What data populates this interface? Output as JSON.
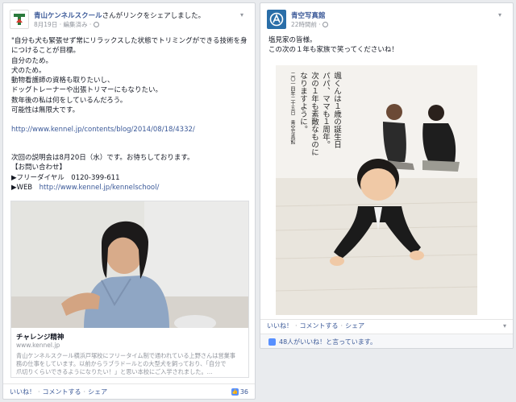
{
  "post1": {
    "page_name": "青山ケンネルスクール",
    "action_text": "さんがリンクをシェアしました。",
    "meta": "8月19日 · 編集済み ·",
    "lines": [
      "\"自分も犬も緊張せず常にリラックスした状態でトリミングができる技術を身",
      "につけることが目標。",
      "自分のため。",
      "犬のため。",
      "動物看護師の資格も取りたいし、",
      "ドッグトレーナーや出張トリマーにもなりたい。",
      "数年後の私は何をしているんだろう。",
      "可能性は無限大です。"
    ],
    "url1": "http://www.kennel.jp/contents/blog/2014/08/18/4332/",
    "lines2": [
      "次回の説明会は8月20日（水）です。お待ちしております。",
      "【お問い合わせ】",
      "▶フリーダイヤル　0120-399-611"
    ],
    "web_label": "▶WEB",
    "web_url": "http://www.kennel.jp/kennelschool/",
    "link_title": "チャレンジ精神",
    "link_domain": "www.kennel.jp",
    "link_desc": [
      "青山ケンネルスクール横浜戸塚校にフリータイム制で通われている上野さんは営業事",
      "務の仕事をしています。以前からラブラドールとの大型犬を飼っており、「自分で",
      "爪切りくらいできるようになりたい！」と思い本校にご入学されました。..."
    ],
    "actions": [
      "いいね！",
      "コメントする",
      "シェア"
    ],
    "like_count": "36"
  },
  "post2": {
    "page_name": "青空写真館",
    "meta": "22時間前 ·",
    "lines": [
      "塩見家の皆様。",
      "この次の１年も家族で笑ってくださいね！"
    ],
    "photo_caption": [
      "颯くんは１歳の誕生日",
      "パパ、ママも１周年。",
      "次の１年も素敵なものに",
      "なりますように。",
      "二〇一四年二十五日　青空写真館"
    ],
    "actions": [
      "いいね！",
      "コメントする",
      "シェア"
    ],
    "likes_text": "48人がいいね！と言っています。"
  },
  "colors": {
    "link": "#3b5998",
    "kennel_green": "#2a7a3c",
    "aozora_blue": "#2a6ea8"
  }
}
